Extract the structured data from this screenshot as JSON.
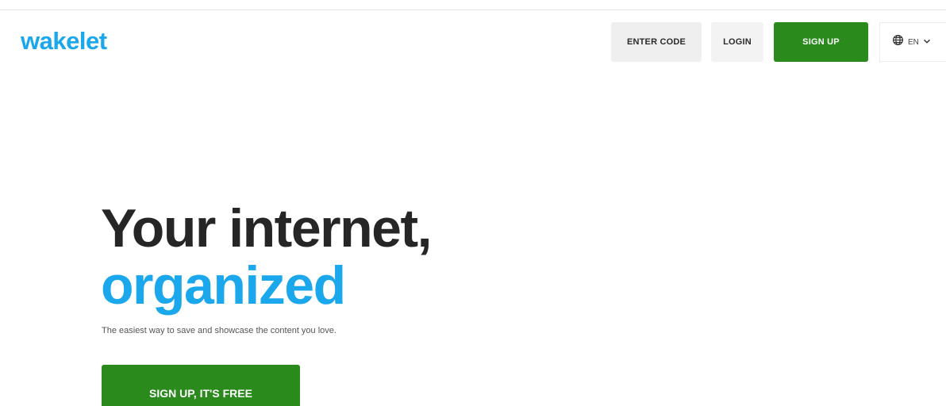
{
  "header": {
    "logo_text": "wakelet",
    "enter_code_label": "ENTER CODE",
    "login_label": "LOGIN",
    "signup_label": "SIGN UP",
    "language": {
      "icon": "globe-icon",
      "code": "EN",
      "chevron_icon": "chevron-down-icon"
    }
  },
  "hero": {
    "headline_line1": "Your internet,",
    "headline_line2": "organized",
    "tagline": "The easiest way to save and showcase the content you love.",
    "cta_label": "SIGN UP, IT'S FREE"
  },
  "colors": {
    "brand_blue": "#1aa7ec",
    "brand_green": "#2a8a1c",
    "headline_dark": "#262626"
  }
}
